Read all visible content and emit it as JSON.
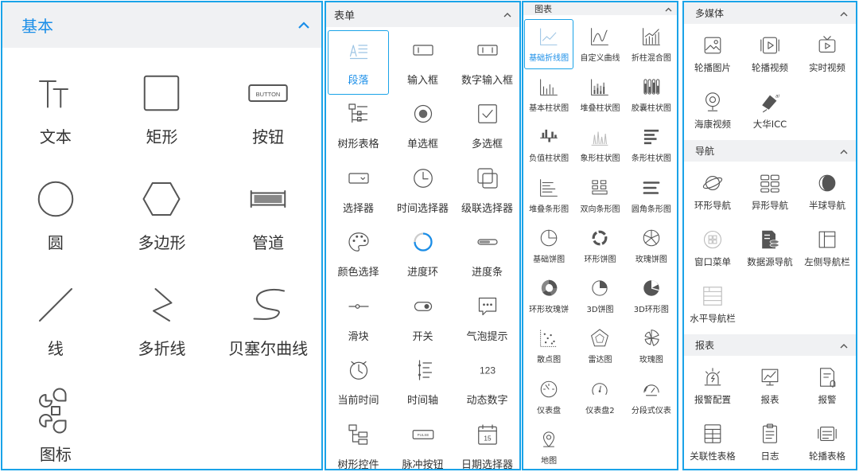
{
  "basic": {
    "title": "基本",
    "items": [
      {
        "label": "文本",
        "icon": "text-icon"
      },
      {
        "label": "矩形",
        "icon": "rectangle-icon"
      },
      {
        "label": "按钮",
        "icon": "button-icon",
        "icon_text": "BUTTON"
      },
      {
        "label": "圆",
        "icon": "circle-icon"
      },
      {
        "label": "多边形",
        "icon": "hexagon-icon"
      },
      {
        "label": "管道",
        "icon": "pipe-icon"
      },
      {
        "label": "线",
        "icon": "line-icon"
      },
      {
        "label": "多折线",
        "icon": "polyline-icon"
      },
      {
        "label": "贝塞尔曲线",
        "icon": "bezier-icon"
      },
      {
        "label": "图标",
        "icon": "icon-grid-icon"
      }
    ]
  },
  "form": {
    "title": "表单",
    "items": [
      {
        "label": "段落",
        "icon": "paragraph-icon",
        "selected": true
      },
      {
        "label": "输入框",
        "icon": "input-icon"
      },
      {
        "label": "数字输入框",
        "icon": "number-input-icon"
      },
      {
        "label": "树形表格",
        "icon": "tree-table-icon"
      },
      {
        "label": "单选框",
        "icon": "radio-icon"
      },
      {
        "label": "多选框",
        "icon": "checkbox-icon"
      },
      {
        "label": "选择器",
        "icon": "select-icon"
      },
      {
        "label": "时间选择器",
        "icon": "clock-icon"
      },
      {
        "label": "级联选择器",
        "icon": "cascader-icon"
      },
      {
        "label": "颜色选择",
        "icon": "palette-icon"
      },
      {
        "label": "进度环",
        "icon": "progress-ring-icon"
      },
      {
        "label": "进度条",
        "icon": "progress-bar-icon"
      },
      {
        "label": "滑块",
        "icon": "slider-icon"
      },
      {
        "label": "开关",
        "icon": "switch-icon"
      },
      {
        "label": "气泡提示",
        "icon": "tooltip-icon"
      },
      {
        "label": "当前时间",
        "icon": "current-time-icon"
      },
      {
        "label": "时间轴",
        "icon": "timeline-icon"
      },
      {
        "label": "动态数字",
        "icon": "dynamic-number-icon",
        "icon_text": "123"
      },
      {
        "label": "树形控件",
        "icon": "tree-icon"
      },
      {
        "label": "脉冲按钮",
        "icon": "pulse-button-icon",
        "icon_text": "PULSE"
      },
      {
        "label": "日期选择器",
        "icon": "calendar-icon",
        "icon_text": "15"
      }
    ]
  },
  "chart": {
    "title": "图表",
    "items": [
      {
        "label": "基础折线图",
        "icon": "line-chart-icon",
        "selected": true
      },
      {
        "label": "自定义曲线",
        "icon": "custom-curve-icon"
      },
      {
        "label": "折柱混合图",
        "icon": "line-bar-mix-icon"
      },
      {
        "label": "基本柱状图",
        "icon": "bar-chart-icon"
      },
      {
        "label": "堆叠柱状图",
        "icon": "stacked-bar-icon"
      },
      {
        "label": "胶囊柱状图",
        "icon": "capsule-bar-icon"
      },
      {
        "label": "负值柱状图",
        "icon": "negative-bar-icon"
      },
      {
        "label": "象形柱状图",
        "icon": "pictorial-bar-icon"
      },
      {
        "label": "条形柱状图",
        "icon": "horizontal-bar-icon"
      },
      {
        "label": "堆叠条形图",
        "icon": "stacked-hbar-icon"
      },
      {
        "label": "双向条形图",
        "icon": "bidirectional-bar-icon"
      },
      {
        "label": "圆角条形图",
        "icon": "rounded-bar-icon"
      },
      {
        "label": "基础饼图",
        "icon": "pie-icon"
      },
      {
        "label": "环形饼图",
        "icon": "donut-icon"
      },
      {
        "label": "玫瑰饼图",
        "icon": "rose-pie-icon"
      },
      {
        "label": "环形玫瑰饼",
        "icon": "rose-donut-icon"
      },
      {
        "label": "3D饼图",
        "icon": "pie-3d-icon"
      },
      {
        "label": "3D环形图",
        "icon": "donut-3d-icon"
      },
      {
        "label": "散点图",
        "icon": "scatter-icon"
      },
      {
        "label": "雷达图",
        "icon": "radar-icon"
      },
      {
        "label": "玫瑰图",
        "icon": "rose-chart-icon"
      },
      {
        "label": "仪表盘",
        "icon": "gauge-icon"
      },
      {
        "label": "仪表盘2",
        "icon": "gauge2-icon"
      },
      {
        "label": "分段式仪表",
        "icon": "segment-gauge-icon"
      },
      {
        "label": "地图",
        "icon": "map-icon"
      }
    ]
  },
  "media": {
    "title": "多媒体",
    "items": [
      {
        "label": "轮播图片",
        "icon": "image-carousel-icon"
      },
      {
        "label": "轮播视频",
        "icon": "video-carousel-icon"
      },
      {
        "label": "实时视频",
        "icon": "live-video-icon"
      },
      {
        "label": "海康视频",
        "icon": "hikvision-icon"
      },
      {
        "label": "大华ICC",
        "icon": "dahua-icon"
      }
    ]
  },
  "nav": {
    "title": "导航",
    "items": [
      {
        "label": "环形导航",
        "icon": "ring-nav-icon"
      },
      {
        "label": "异形导航",
        "icon": "shaped-nav-icon"
      },
      {
        "label": "半球导航",
        "icon": "hemisphere-nav-icon"
      },
      {
        "label": "窗口菜单",
        "icon": "window-menu-icon"
      },
      {
        "label": "数据源导航",
        "icon": "datasource-nav-icon"
      },
      {
        "label": "左侧导航栏",
        "icon": "left-nav-icon"
      },
      {
        "label": "水平导航栏",
        "icon": "horizontal-nav-icon"
      }
    ]
  },
  "report": {
    "title": "报表",
    "items": [
      {
        "label": "报警配置",
        "icon": "alarm-config-icon"
      },
      {
        "label": "报表",
        "icon": "report-icon"
      },
      {
        "label": "报警",
        "icon": "alarm-icon"
      },
      {
        "label": "关联性表格",
        "icon": "related-table-icon"
      },
      {
        "label": "日志",
        "icon": "log-icon"
      },
      {
        "label": "轮播表格",
        "icon": "carousel-table-icon"
      }
    ]
  },
  "chevron_glyph": "︿"
}
